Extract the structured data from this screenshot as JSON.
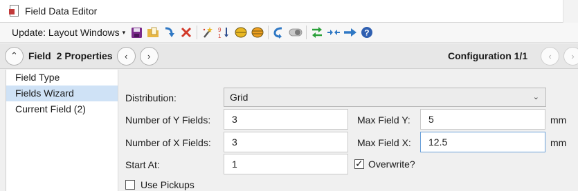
{
  "window": {
    "title": "Field Data Editor"
  },
  "toolbar": {
    "update_label": "Update: Layout Windows",
    "icons": [
      "save-icon",
      "open-folder-icon",
      "insert-down-arrow-icon",
      "delete-x-icon",
      "wizard-wand-icon",
      "sort-icon",
      "ellipse-yellow-icon",
      "ellipse-orange-icon",
      "undo-arrow-icon",
      "toggle-icon",
      "green-arrows-icon",
      "collapse-arrows-icon",
      "blue-right-arrow-icon",
      "help-icon"
    ]
  },
  "header": {
    "field_label": "Field",
    "properties_label": "2 Properties",
    "configuration_label": "Configuration 1/1"
  },
  "nav": {
    "items": [
      "Field Type",
      "Fields Wizard",
      "Current Field (2)"
    ],
    "selected_index": 1
  },
  "form": {
    "distribution_label": "Distribution:",
    "distribution_value": "Grid",
    "num_y_label": "Number of Y Fields:",
    "num_y_value": "3",
    "num_x_label": "Number of X Fields:",
    "num_x_value": "3",
    "start_at_label": "Start At:",
    "start_at_value": "1",
    "max_y_label": "Max Field Y:",
    "max_y_value": "5",
    "max_x_label": "Max Field X:",
    "max_x_value": "12.5",
    "unit_y": "mm",
    "unit_x": "mm",
    "overwrite_label": "Overwrite?",
    "overwrite_checked": true,
    "use_pickups_label": "Use Pickups",
    "use_pickups_checked": false
  },
  "colors": {
    "selection": "#cfe2f6",
    "accent_blue": "#2f78c4",
    "save_purple": "#7a2a8a",
    "delete_red": "#d23a2a",
    "ellipse_yellow": "#e9b824",
    "green": "#2aa03a"
  }
}
